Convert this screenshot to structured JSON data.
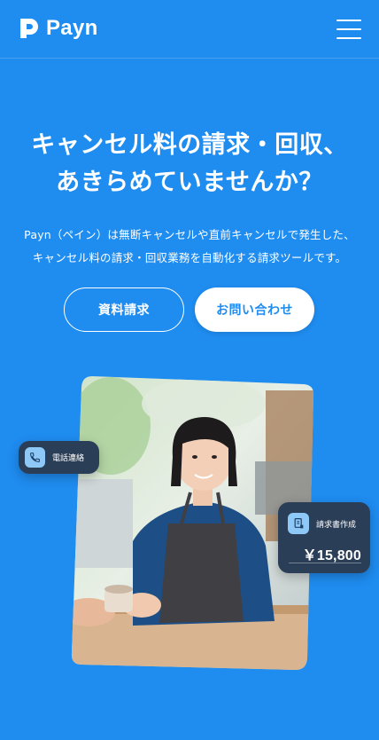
{
  "header": {
    "logo_text": "Payn"
  },
  "hero": {
    "title_lines": [
      "キャンセル料の請求・回収、",
      "あきらめていませんか？"
    ],
    "description_lines": [
      "Payn（ペイン）は無断キャンセルや直前キャンセルで発生した、",
      "キャンセル料の請求・回収業務を自動化する請求ツールです。"
    ]
  },
  "buttons": {
    "request_docs": "資料請求",
    "contact": "お問い合わせ"
  },
  "cards": {
    "call": {
      "label": "電話連絡"
    },
    "invoice": {
      "label": "請求書作成",
      "amount": "￥15,800"
    }
  },
  "colors": {
    "background": "#1f8cf0",
    "card": "#2b3e57",
    "icon_bg": "#8ec8f6"
  }
}
